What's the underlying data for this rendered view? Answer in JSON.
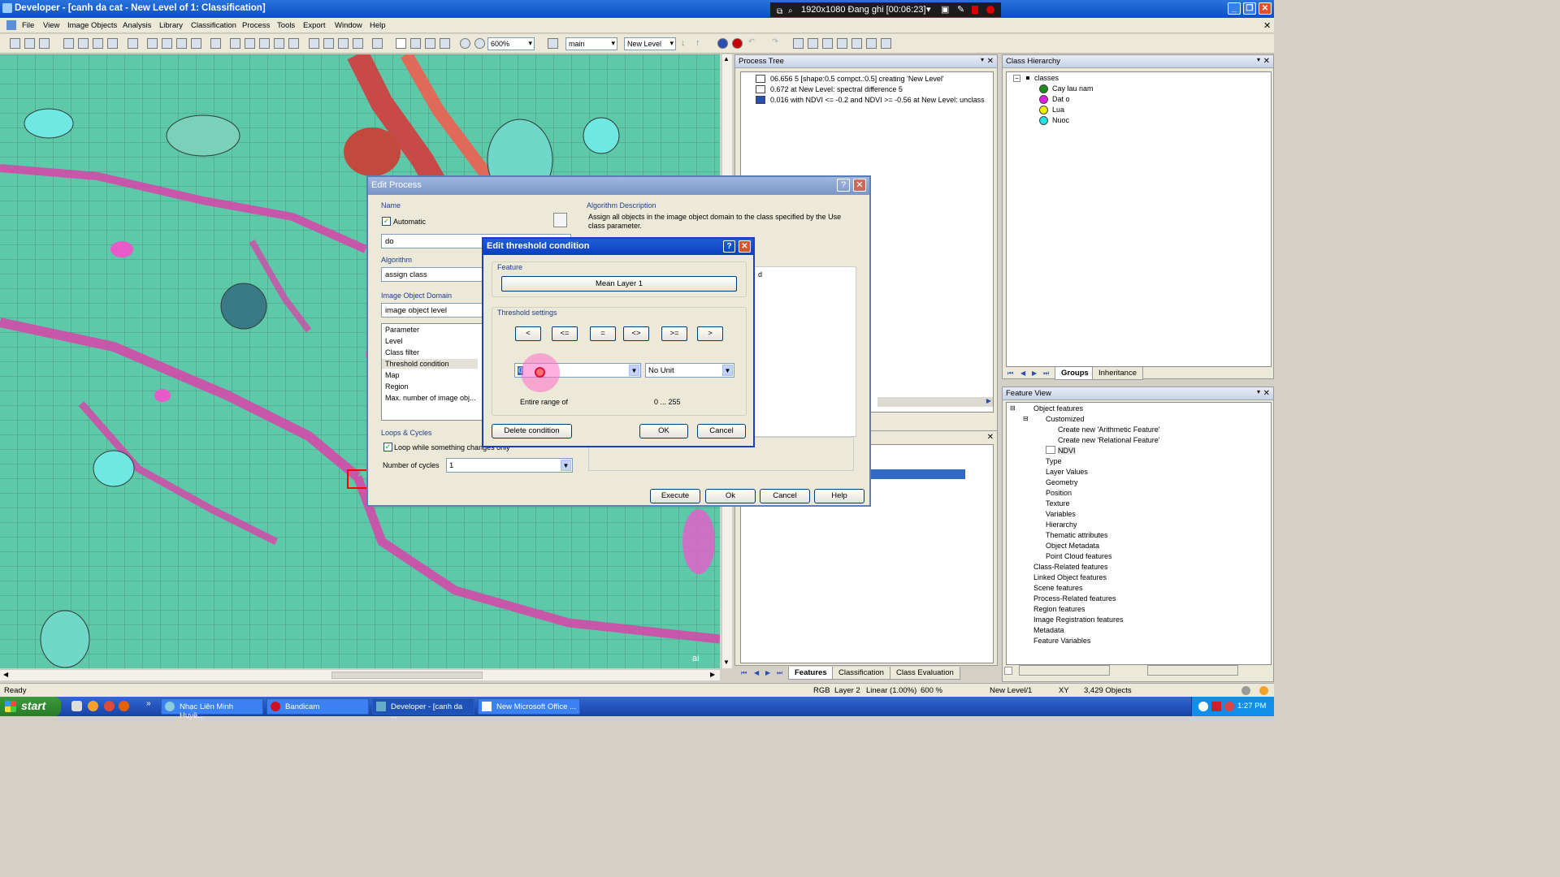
{
  "window": {
    "title": "Developer - [canh da cat - New Level of 1: Classification]"
  },
  "recorder": {
    "text": "1920x1080 Đang ghi [00:06:23]"
  },
  "menu": [
    "File",
    "View",
    "Image Objects",
    "Analysis",
    "Library",
    "Classification",
    "Process",
    "Tools",
    "Export",
    "Window",
    "Help"
  ],
  "toolbar": {
    "zoom": "600%",
    "map": "main",
    "level": "New Level"
  },
  "process_tree": {
    "title": "Process Tree",
    "rows": [
      "06.656   5 [shape:0.5 compct.:0.5] creating 'New Level'",
      "0.672   at  New Level: spectral difference 5",
      "0.016   with NDVI <= -0.2  and NDVI >= -0.56  at  New Level: unclass"
    ]
  },
  "class_hierarchy": {
    "title": "Class Hierarchy",
    "root": "classes",
    "classes": [
      {
        "name": "Cay lau nam",
        "color": "#1a8a1a"
      },
      {
        "name": "Dat o",
        "color": "#e020e0"
      },
      {
        "name": "Lua",
        "color": "#f0f000"
      },
      {
        "name": "Nuoc",
        "color": "#20e0e0"
      }
    ],
    "tabs": [
      "Groups",
      "Inheritance"
    ]
  },
  "feature_view": {
    "title": "Feature View",
    "items": [
      "Object features",
      "Customized",
      "Create new 'Arithmetic Feature'",
      "Create new 'Relational Feature'",
      "NDVI",
      "Type",
      "Layer Values",
      "Geometry",
      "Position",
      "Texture",
      "Variables",
      "Hierarchy",
      "Thematic attributes",
      "Object Metadata",
      "Point Cloud features",
      "Class-Related features",
      "Linked Object features",
      "Scene features",
      "Process-Related features",
      "Region features",
      "Image Registration features",
      "Metadata",
      "Feature Variables"
    ],
    "tabs": [
      "Features",
      "Classification",
      "Class Evaluation"
    ]
  },
  "edit_process": {
    "title": "Edit Process",
    "name_label": "Name",
    "automatic_label": "Automatic",
    "name_value": "do",
    "algorithm_label": "Algorithm",
    "algorithm_value": "assign class",
    "domain_label": "Image Object Domain",
    "domain_value": "image object level",
    "param_header": "Parameter",
    "params": [
      "Level",
      "Class filter",
      "Threshold condition",
      "Map",
      "Region",
      "Max. number of image obj..."
    ],
    "loops_label": "Loops & Cycles",
    "loop_check": "Loop while something changes only",
    "cycles_label": "Number of cycles",
    "cycles_value": "1",
    "desc_label": "Algorithm Description",
    "desc_text": "Assign all objects in the image object domain to the class specified by the Use class parameter.",
    "partial_value": "d",
    "buttons": {
      "execute": "Execute",
      "ok": "Ok",
      "cancel": "Cancel",
      "help": "Help"
    }
  },
  "threshold": {
    "title": "Edit threshold condition",
    "feature_label": "Feature",
    "feature_value": "Mean Layer 1",
    "settings_label": "Threshold settings",
    "operators": [
      "<",
      "<=",
      "=",
      "<>",
      ">=",
      ">"
    ],
    "value": "0",
    "unit": "No Unit",
    "range_label": "Entire range of",
    "range_value": "0 ... 255",
    "buttons": {
      "delete": "Delete condition",
      "ok": "OK",
      "cancel": "Cancel"
    }
  },
  "map_overlay": "ai",
  "status": {
    "ready": "Ready",
    "rgb": "RGB",
    "layer": "Layer 2",
    "stretch": "Linear (1.00%)",
    "zoom": "600 %",
    "level": "New Level/1",
    "xy": "XY",
    "objects": "3,429 Objects"
  },
  "taskbar": {
    "start": "start",
    "tasks": [
      "Nhạc Liên Minh Huyề...",
      "Bandicam",
      "Developer - [canh da ...",
      "New Microsoft Office ..."
    ],
    "clock": "1:27 PM"
  }
}
